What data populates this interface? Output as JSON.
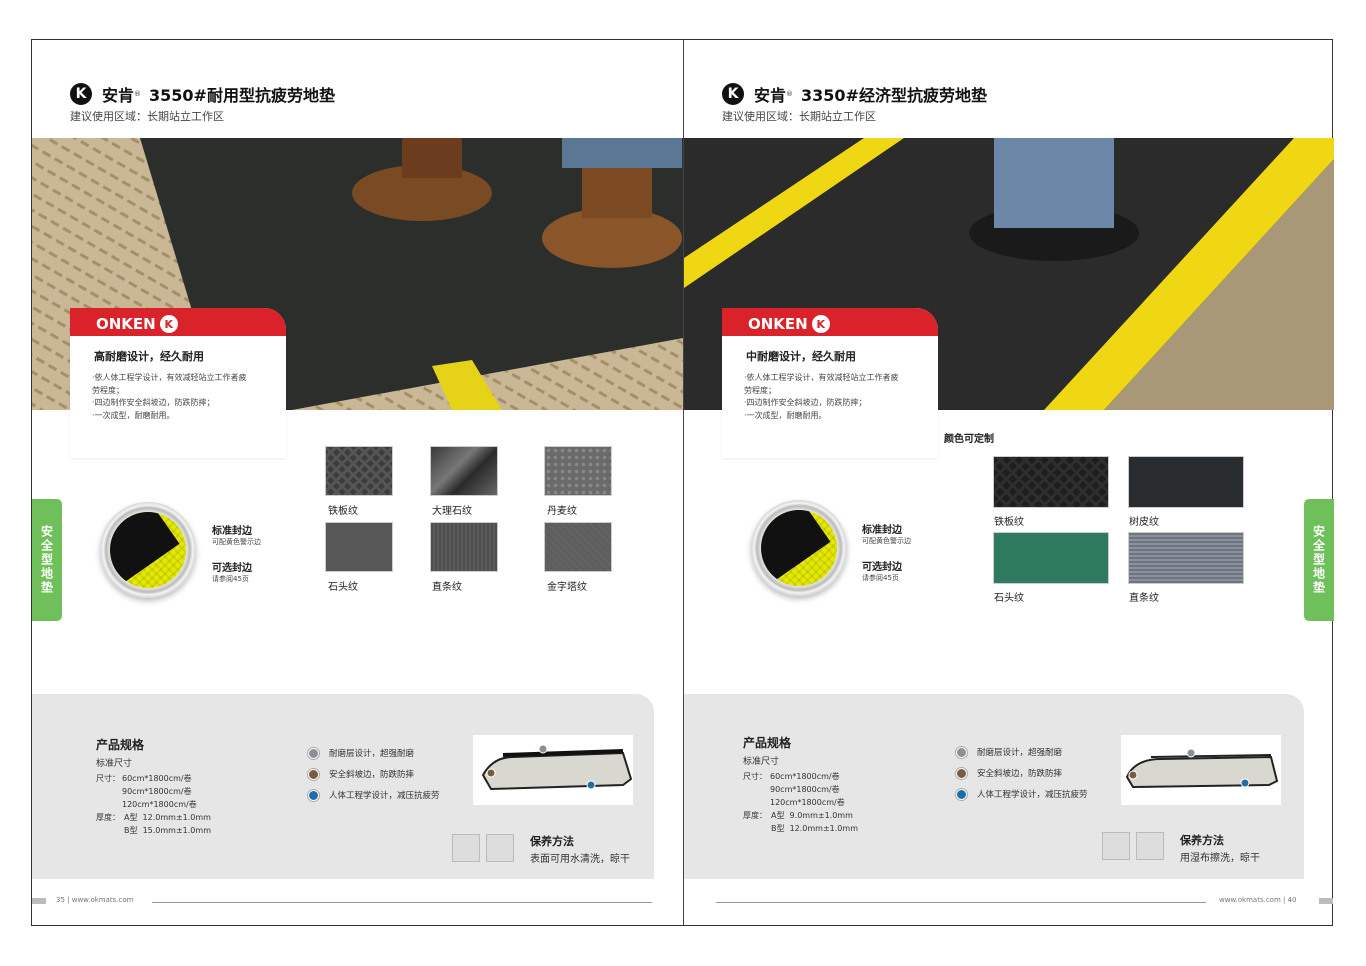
{
  "left_page": {
    "logo": "K",
    "brand": "安肯",
    "reg": "®",
    "title": "3550#耐用型抗疲劳地垫",
    "subtitle": "建议使用区域：长期站立工作区",
    "card": {
      "brand": "ONKEN",
      "logo": "K",
      "heading": "高耐磨设计，经久耐用",
      "lines": [
        "·依人体工程学设计，有效减轻站立工作者疲",
        "劳程度；",
        "·四边制作安全斜坡边，防跌防摔；",
        "·一次成型，耐磨耐用。"
      ]
    },
    "edge": {
      "standard_label": "标准封边",
      "standard_note": "可配黄色警示边",
      "optional_label": "可选封边",
      "optional_note": "请参阅45页"
    },
    "swatches": [
      {
        "label": "铁板纹",
        "color": "#3c3c3c"
      },
      {
        "label": "大理石纹",
        "color": "#4a4a4a"
      },
      {
        "label": "丹麦纹",
        "color": "#6a6a6a"
      },
      {
        "label": "石头纹",
        "color": "#575757"
      },
      {
        "label": "直条纹",
        "color": "#4e4e4e"
      },
      {
        "label": "金字塔纹",
        "color": "#5e5e5e"
      }
    ],
    "spec": {
      "title": "产品规格",
      "sub": "标准尺寸",
      "size_label": "尺寸：",
      "sizes": [
        "60cm*1800cm/卷",
        "90cm*1800cm/卷",
        "120cm*1800cm/卷"
      ],
      "thick_label": "厚度：",
      "thicknesses": [
        "A型  12.0mm±1.0mm",
        "B型  15.0mm±1.0mm"
      ]
    },
    "features": [
      {
        "text": "耐磨层设计，超强耐磨",
        "color": "#8a9099"
      },
      {
        "text": "安全斜坡边，防跌防摔",
        "color": "#7a5a40"
      },
      {
        "text": "人体工程学设计，减压抗疲劳",
        "color": "#1e6fa8"
      }
    ],
    "care": {
      "title": "保养方法",
      "text": "表面可用水清洗，晾干"
    },
    "side_tab": "安全型地垫",
    "footer": "35 | www.okmats.com"
  },
  "right_page": {
    "logo": "K",
    "brand": "安肯",
    "reg": "®",
    "title": "3350#经济型抗疲劳地垫",
    "subtitle": "建议使用区域：长期站立工作区",
    "card": {
      "brand": "ONKEN",
      "logo": "K",
      "heading": "中耐磨设计，经久耐用",
      "lines": [
        "·依人体工程学设计，有效减轻站立工作者疲",
        "劳程度；",
        "·四边制作安全斜坡边，防跌防摔；",
        "·一次成型，耐磨耐用。"
      ]
    },
    "edge": {
      "standard_label": "标准封边",
      "standard_note": "可配黄色警示边",
      "optional_label": "可选封边",
      "optional_note": "请参阅45页"
    },
    "color_custom": "颜色可定制",
    "swatches": [
      {
        "label": "铁板纹",
        "color": "#1e1e1e"
      },
      {
        "label": "树皮纹",
        "color": "#2a2d30"
      },
      {
        "label": "石头纹",
        "color": "#2d7a5f"
      },
      {
        "label": "直条纹",
        "color": "#6e7480"
      }
    ],
    "spec": {
      "title": "产品规格",
      "sub": "标准尺寸",
      "size_label": "尺寸：",
      "sizes": [
        "60cm*1800cm/卷",
        "90cm*1800cm/卷",
        "120cm*1800cm/卷"
      ],
      "thick_label": "厚度：",
      "thicknesses": [
        "A型  9.0mm±1.0mm",
        "B型  12.0mm±1.0mm"
      ]
    },
    "features": [
      {
        "text": "耐磨层设计，超强耐磨",
        "color": "#8a9099"
      },
      {
        "text": "安全斜坡边，防跌防摔",
        "color": "#7a5a40"
      },
      {
        "text": "人体工程学设计，减压抗疲劳",
        "color": "#1e6fa8"
      }
    ],
    "care": {
      "title": "保养方法",
      "text": "用湿布擦洗，晾干"
    },
    "side_tab": "安全型地垫",
    "footer": "www.okmats.com | 40"
  }
}
